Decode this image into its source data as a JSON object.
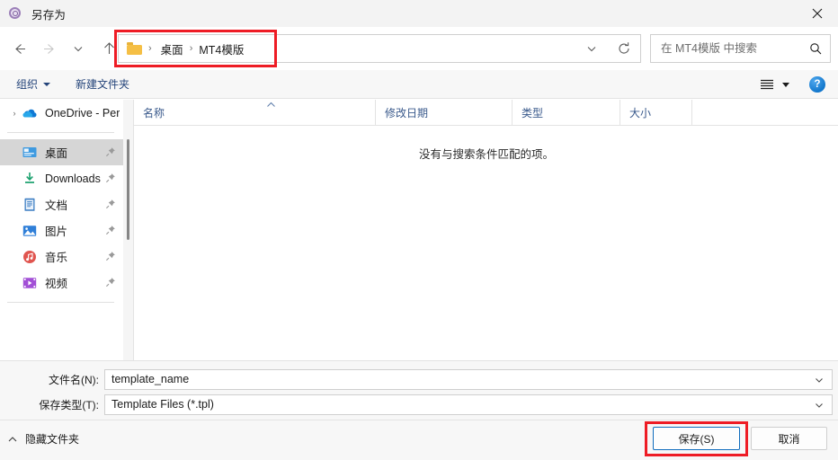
{
  "window": {
    "title": "另存为",
    "icon": "app-circle-icon",
    "close_label": "✕"
  },
  "nav": {
    "back": "back-arrow",
    "forward": "forward-arrow",
    "recent": "recent-locations-chevron",
    "up": "up-arrow",
    "breadcrumb": {
      "folder_icon": "folder-icon",
      "separator": "›",
      "items": [
        "桌面",
        "MT4模版"
      ]
    },
    "dropdown": "previous-locations-chevron",
    "refresh": "refresh-icon",
    "search": {
      "placeholder": "在 MT4模版 中搜索",
      "value": "",
      "icon": "search-icon"
    }
  },
  "commandbar": {
    "organize": "组织",
    "new_folder": "新建文件夹",
    "view_icon": "view-options-icon",
    "help_icon": "?",
    "help_color": "#1277cc"
  },
  "sidebar": {
    "items": [
      {
        "label": "OneDrive - Per",
        "icon": "onedrive-cloud-icon",
        "expander": "›",
        "pinned": false,
        "selected": false
      },
      {
        "label": "桌面",
        "icon": "desktop-icon",
        "expander": "",
        "pinned": true,
        "selected": true
      },
      {
        "label": "Downloads",
        "icon": "downloads-icon",
        "expander": "",
        "pinned": true,
        "selected": false
      },
      {
        "label": "文档",
        "icon": "documents-icon",
        "expander": "",
        "pinned": true,
        "selected": false
      },
      {
        "label": "图片",
        "icon": "pictures-icon",
        "expander": "",
        "pinned": true,
        "selected": false
      },
      {
        "label": "音乐",
        "icon": "music-icon",
        "expander": "",
        "pinned": true,
        "selected": false
      },
      {
        "label": "视频",
        "icon": "videos-icon",
        "expander": "",
        "pinned": true,
        "selected": false
      }
    ]
  },
  "filelist": {
    "columns": [
      {
        "label": "名称",
        "sorted": true,
        "sort_direction": "asc"
      },
      {
        "label": "修改日期",
        "sorted": false,
        "sort_direction": ""
      },
      {
        "label": "类型",
        "sorted": false,
        "sort_direction": ""
      },
      {
        "label": "大小",
        "sorted": false,
        "sort_direction": ""
      }
    ],
    "rows": [],
    "empty_message": "没有与搜索条件匹配的项。"
  },
  "form": {
    "filename_label": "文件名(N):",
    "filename_value": "template_name",
    "filetype_label": "保存类型(T):",
    "filetype_value": "Template Files (*.tpl)",
    "chevron": "chevron-down-icon"
  },
  "footer": {
    "hide_folders": "隐藏文件夹",
    "hide_chevron": "chevron-up-icon",
    "save_button": "保存(S)",
    "cancel_button": "取消"
  },
  "annotations": {
    "color": "#ee1c25",
    "boxes": [
      "breadcrumb-highlight",
      "save-button-highlight"
    ]
  }
}
